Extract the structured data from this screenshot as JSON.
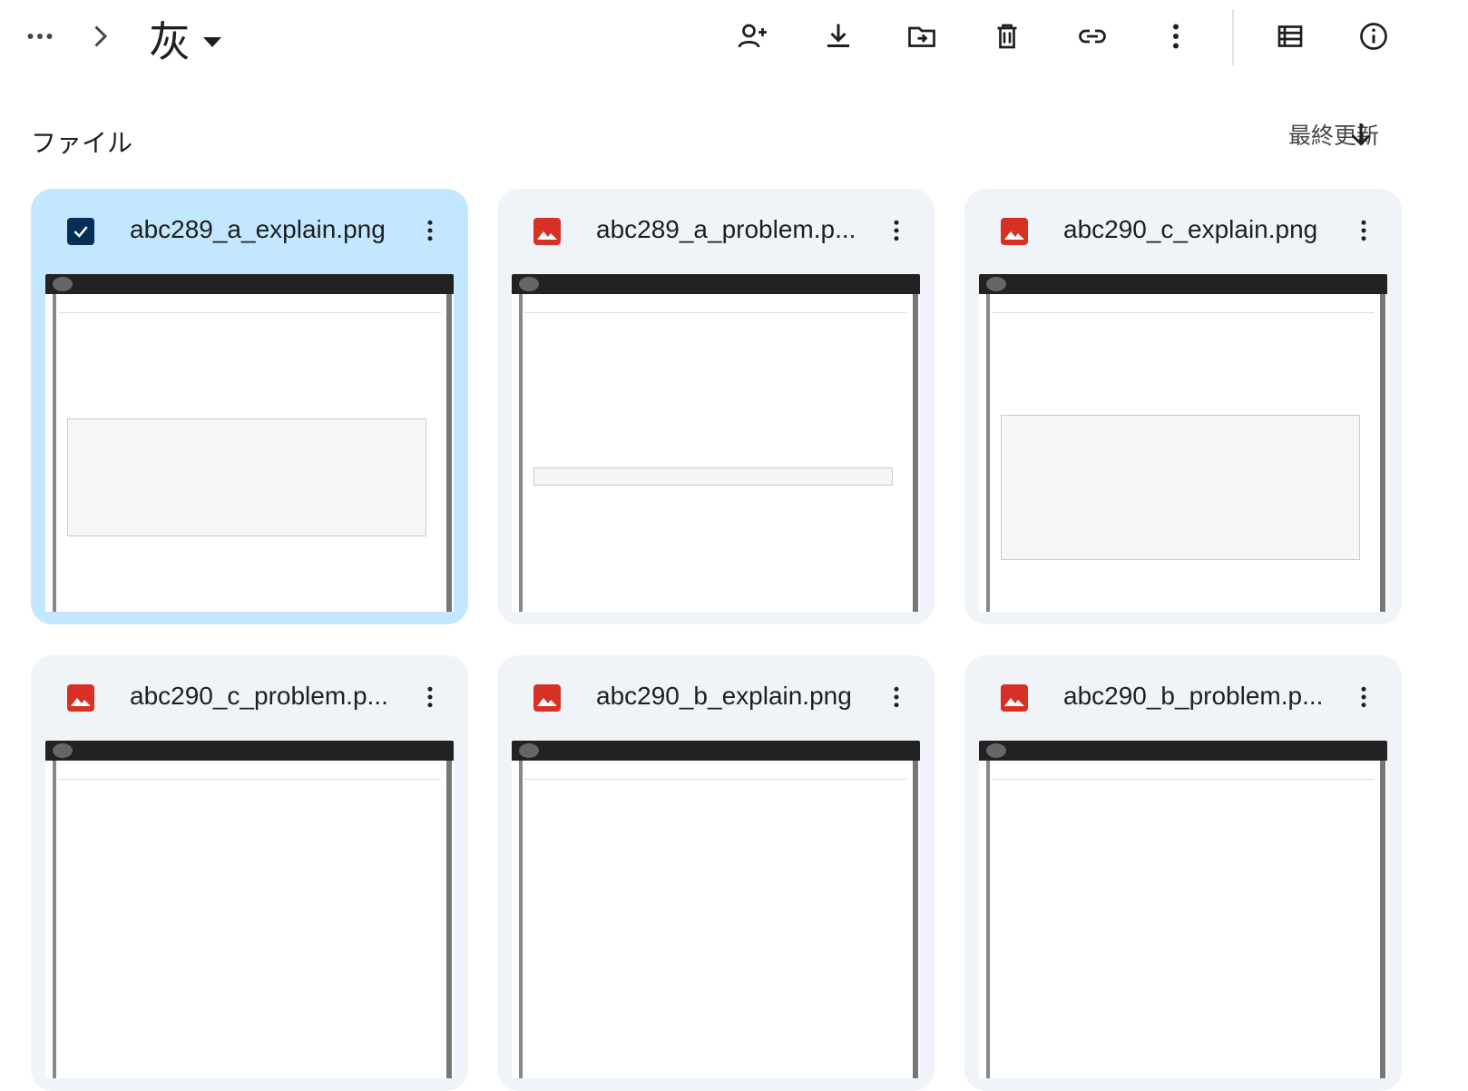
{
  "toolbar": {
    "folder_name": "灰",
    "icons": [
      "more-horiz-icon",
      "chevron-right-icon",
      "add-person-icon",
      "download-icon",
      "move-to-folder-icon",
      "trash-icon",
      "link-icon",
      "more-vert-icon",
      "list-view-icon",
      "info-icon"
    ]
  },
  "section": {
    "title": "ファイル",
    "sort_label": "最終更新"
  },
  "files": [
    {
      "name": "abc289_a_explain.png",
      "selected": true
    },
    {
      "name": "abc289_a_problem.p...",
      "selected": false
    },
    {
      "name": "abc290_c_explain.png",
      "selected": false
    },
    {
      "name": "abc290_c_problem.p...",
      "selected": false
    },
    {
      "name": "abc290_b_explain.png",
      "selected": false
    },
    {
      "name": "abc290_b_problem.p...",
      "selected": false
    }
  ],
  "colors": {
    "selected_card": "#c2e7ff",
    "card": "#f0f4f9",
    "image_icon": "#d93025",
    "checkbox": "#072e58"
  }
}
